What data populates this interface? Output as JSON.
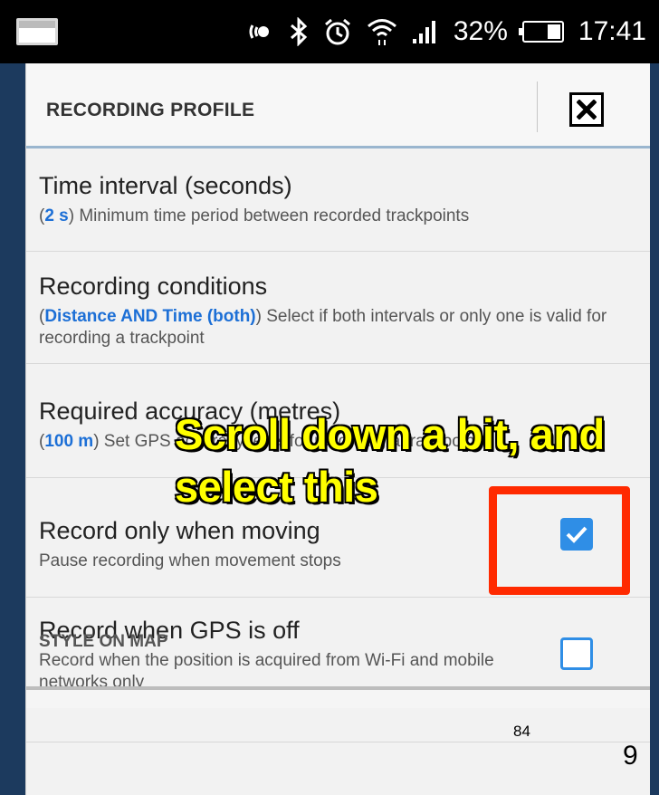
{
  "status_bar": {
    "icons": [
      "gallery-icon",
      "nfc-icon",
      "bluetooth-icon",
      "alarm-icon",
      "wifi-icon",
      "signal-icon",
      "battery-icon"
    ],
    "battery": "32%",
    "time": "17:41"
  },
  "dialog": {
    "title": "RECORDING PROFILE",
    "close_icon": "close-icon"
  },
  "settings": [
    {
      "title": "Time interval (seconds)",
      "value": "2 s",
      "description": " Minimum time period between recorded trackpoints"
    },
    {
      "title": "Recording conditions",
      "value": "Distance AND Time (both)",
      "description": " Select if both intervals or only one is valid for recording a trackpoint"
    },
    {
      "title": "Required accuracy (metres)",
      "value": "100 m",
      "description": " Set GPS accuracy level for recording a trackpoint"
    },
    {
      "title": "Record only when moving",
      "description": "Pause recording when movement stops",
      "checked": true
    },
    {
      "title": "Record when GPS is off",
      "description": "Record when the position is acquired from Wi-Fi and mobile networks only",
      "checked": false
    }
  ],
  "section": {
    "label": "STYLE ON MAP"
  },
  "annotation": {
    "line1": "Scroll down a bit, and",
    "line2": "select this",
    "highlight_color": "#ff2a00",
    "text_color": "#ffff00"
  },
  "footer": {
    "page_number": "84",
    "slide_number": "9"
  },
  "colors": {
    "accent": "#2f8ee6",
    "value_text": "#1c6fd6"
  }
}
